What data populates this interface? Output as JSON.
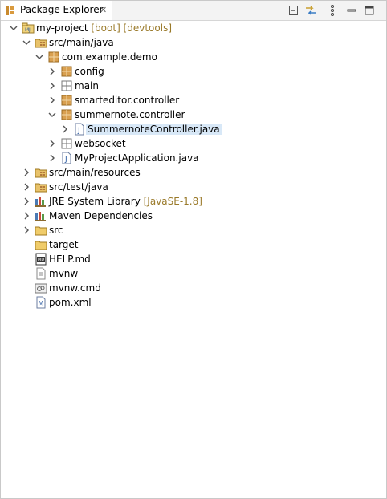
{
  "view": {
    "tab_label": "Package Explorer",
    "tab_icon": "package-explorer-icon",
    "close_icon": "close-icon",
    "toolbar": [
      {
        "name": "collapse-all-button",
        "icon": "collapse-all-icon"
      },
      {
        "name": "link-with-editor-button",
        "icon": "link-with-editor-icon"
      },
      {
        "name": "view-menu-button",
        "icon": "kebab-menu-icon"
      },
      {
        "name": "minimize-button",
        "icon": "minimize-icon"
      },
      {
        "name": "maximize-button",
        "icon": "maximize-icon"
      }
    ]
  },
  "tree": [
    {
      "label": "my-project",
      "decoration": " [boot] [devtools]",
      "icon": "project-icon",
      "level": 0,
      "expanded": true
    },
    {
      "label": "src/main/java",
      "decoration": "",
      "icon": "source-folder-icon",
      "level": 1,
      "expanded": true
    },
    {
      "label": "com.example.demo",
      "decoration": "",
      "icon": "package-icon",
      "level": 2,
      "expanded": true
    },
    {
      "label": "config",
      "decoration": "",
      "icon": "package-icon",
      "level": 3,
      "expanded": false
    },
    {
      "label": "main",
      "decoration": "",
      "icon": "empty-package-icon",
      "level": 3,
      "expanded": false
    },
    {
      "label": "smarteditor.controller",
      "decoration": "",
      "icon": "package-icon",
      "level": 3,
      "expanded": false
    },
    {
      "label": "summernote.controller",
      "decoration": "",
      "icon": "package-icon",
      "level": 3,
      "expanded": true
    },
    {
      "label": "SummernoteController.java",
      "decoration": "",
      "icon": "java-file-icon",
      "level": 4,
      "expanded": false,
      "selected": true
    },
    {
      "label": "websocket",
      "decoration": "",
      "icon": "empty-package-icon",
      "level": 3,
      "expanded": false
    },
    {
      "label": "MyProjectApplication.java",
      "decoration": "",
      "icon": "java-file-icon",
      "level": 3,
      "expanded": false
    },
    {
      "label": "src/main/resources",
      "decoration": "",
      "icon": "source-folder-icon",
      "level": 1,
      "expanded": false
    },
    {
      "label": "src/test/java",
      "decoration": "",
      "icon": "source-folder-icon",
      "level": 1,
      "expanded": false
    },
    {
      "label": "JRE System Library",
      "decoration": " [JavaSE-1.8]",
      "icon": "library-icon",
      "level": 1,
      "expanded": false
    },
    {
      "label": "Maven Dependencies",
      "decoration": "",
      "icon": "library-icon",
      "level": 1,
      "expanded": false
    },
    {
      "label": "src",
      "decoration": "",
      "icon": "folder-icon",
      "level": 1,
      "expanded": false
    },
    {
      "label": "target",
      "decoration": "",
      "icon": "folder-icon",
      "level": 1,
      "expanded": null
    },
    {
      "label": "HELP.md",
      "decoration": "",
      "icon": "markdown-file-icon",
      "level": 1,
      "expanded": null
    },
    {
      "label": "mvnw",
      "decoration": "",
      "icon": "text-file-icon",
      "level": 1,
      "expanded": null
    },
    {
      "label": "mvnw.cmd",
      "decoration": "",
      "icon": "cmd-file-icon",
      "level": 1,
      "expanded": null
    },
    {
      "label": "pom.xml",
      "decoration": "",
      "icon": "maven-pom-icon",
      "level": 1,
      "expanded": null
    }
  ]
}
